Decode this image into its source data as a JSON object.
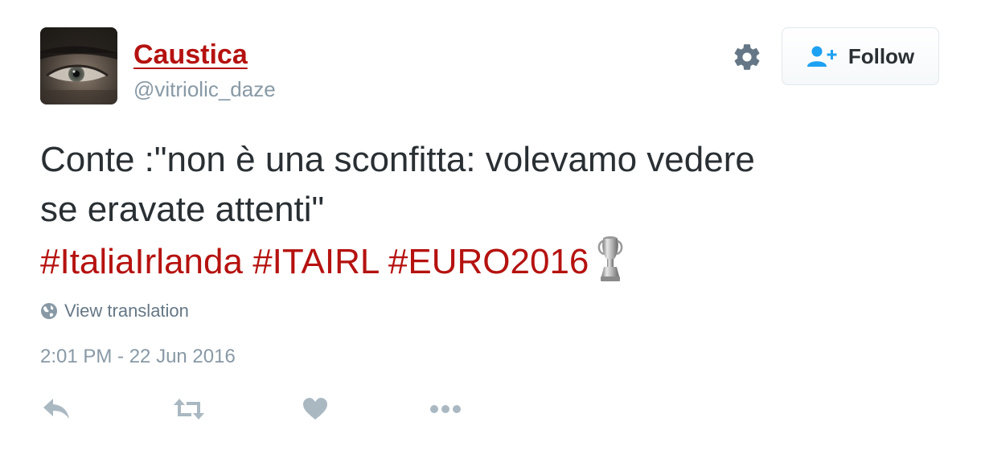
{
  "user": {
    "name": "Caustica",
    "handle": "@vitriolic_daze",
    "avatar_icon": "avatar-photo-eye"
  },
  "header": {
    "settings_icon": "gear-icon",
    "follow_icon": "user-plus-icon",
    "follow_label": "Follow"
  },
  "tweet": {
    "text_line1": "Conte :\"non è una sconfitta: volevamo vedere",
    "text_line2": "se eravate attenti\"",
    "hashtags": [
      "#ItaliaIrlanda",
      "#ITAIRL",
      "#EURO2016"
    ],
    "hashtag_emoji": "euro-trophy-icon",
    "view_translation": "View translation",
    "timestamp": "2:01 PM - 22 Jun 2016"
  },
  "actions": {
    "icons": [
      "reply-icon",
      "retweet-icon",
      "like-icon",
      "more-icon"
    ]
  },
  "colors": {
    "link": "#b5120f",
    "text": "#292f33",
    "muted": "#8899a6",
    "icon": "#aab8c2",
    "follow_icon": "#1da1f2"
  }
}
